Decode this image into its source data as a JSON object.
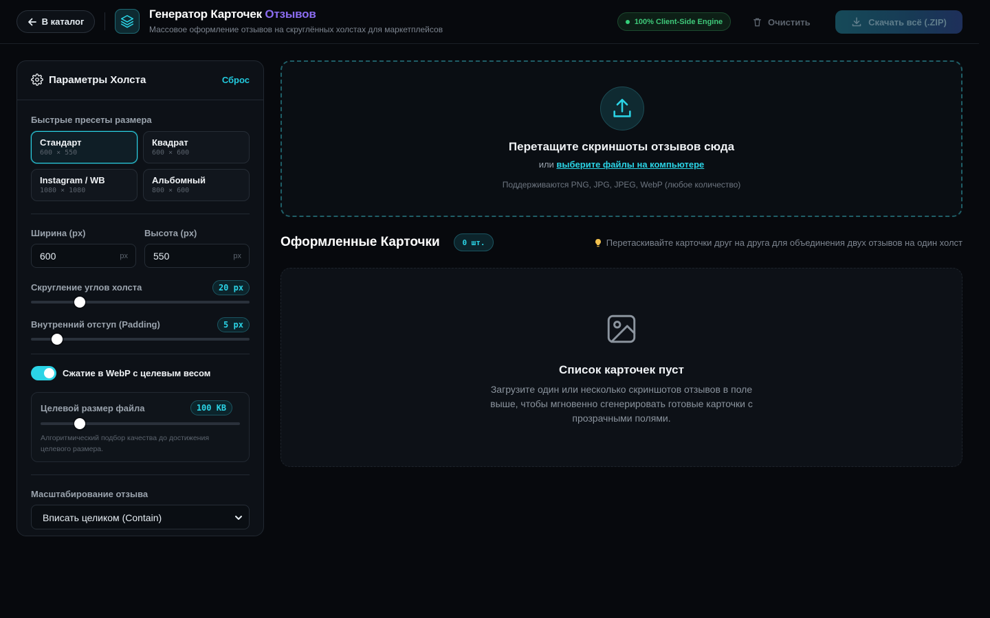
{
  "header": {
    "back_label": "В каталог",
    "title_main": "Генератор Карточек",
    "title_accent": "Отзывов",
    "subtitle": "Массовое оформление отзывов на скруглённых холстах для маркетплейсов",
    "engine_badge": "100% Client-Side Engine",
    "clear_label": "Очистить",
    "download_label": "Скачать всё (.ZIP)"
  },
  "sidebar": {
    "title": "Параметры Холста",
    "reset_label": "Сброс",
    "presets_label": "Быстрые пресеты размера",
    "presets": [
      {
        "name": "Стандарт",
        "dims": "600 × 550",
        "active": true
      },
      {
        "name": "Квадрат",
        "dims": "600 × 600",
        "active": false
      },
      {
        "name": "Instagram / WB",
        "dims": "1080 × 1080",
        "active": false
      },
      {
        "name": "Альбомный",
        "dims": "800 × 600",
        "active": false
      }
    ],
    "width": {
      "label": "Ширина (px)",
      "value": "600",
      "unit": "px"
    },
    "height": {
      "label": "Высота (px)",
      "value": "550",
      "unit": "px"
    },
    "radius": {
      "label": "Скругление углов холста",
      "value_label": "20 px",
      "fraction": 0.21
    },
    "padding": {
      "label": "Внутренний отступ (Padding)",
      "value_label": "5 px",
      "fraction": 0.1
    },
    "webp": {
      "enabled": true,
      "label": "Сжатие в WebP с целевым весом"
    },
    "target_size": {
      "label": "Целевой размер файла",
      "value_label": "100 KB",
      "fraction": 0.18,
      "note": "Алгоритмический подбор качества до достижения целевого размера."
    },
    "scaling": {
      "label": "Масштабирование отзыва",
      "value": "Вписать целиком (Contain)"
    }
  },
  "dropzone": {
    "title": "Перетащите скриншоты отзывов сюда",
    "or_text": "или",
    "link_text": "выберите файлы на компьютере",
    "formats": "Поддерживаются PNG, JPG, JPEG, WebP (любое количество)"
  },
  "cards": {
    "title": "Оформленные Карточки",
    "count": "0 шт.",
    "hint": "Перетаскивайте карточки друг на друга для объединения двух отзывов на один холст",
    "empty_title": "Список карточек пуст",
    "empty_text": "Загрузите один или несколько скриншотов отзывов в поле выше, чтобы мгновенно сгенерировать готовые карточки с прозрачными полями."
  },
  "colors": {
    "accent": "#2bd4e6",
    "title_accent": "#8b6cf0",
    "success": "#34d17a",
    "background": "#07090d"
  }
}
